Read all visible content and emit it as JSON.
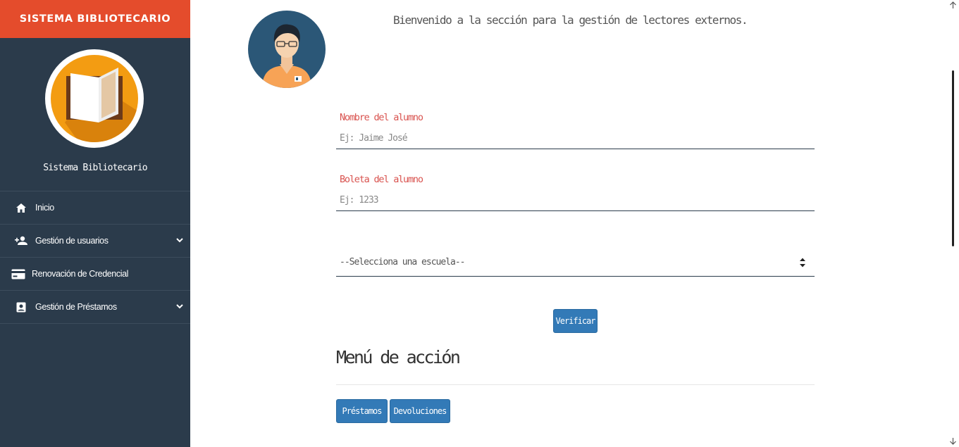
{
  "sidebar": {
    "brand": "SISTEMA BIBLIOTECARIO",
    "logo_icon": "open-book-logo",
    "user_label": "Sistema Bibliotecario",
    "items": [
      {
        "label": "Inicio",
        "icon": "home-icon",
        "has_submenu": false
      },
      {
        "label": "Gestión de usuarios",
        "icon": "add-user-icon",
        "has_submenu": true
      },
      {
        "label": "Renovación de Credencial",
        "icon": "credit-card-icon",
        "has_submenu": false
      },
      {
        "label": "Gestión de Préstamos",
        "icon": "portrait-icon",
        "has_submenu": true
      }
    ]
  },
  "main": {
    "avatar_icon": "user-avatar-illustration",
    "welcome": "Bienvenido a la sección para la gestión de lectores externos.",
    "form": {
      "name_label": "Nombre del alumno",
      "name_placeholder": "Ej: Jaime José",
      "boleta_label": "Boleta del alumno",
      "boleta_placeholder": "Ej: 1233",
      "school_select": "--Selecciona una escuela--",
      "verify_button": "Verificar"
    },
    "action_menu": {
      "title": "Menú de acción",
      "buttons": [
        "Préstamos",
        "Devoluciones"
      ]
    }
  },
  "colors": {
    "brand": "#e44c2c",
    "sidebar": "#2b3b4b",
    "label": "#d9534f",
    "button": "#337ab7",
    "logo": "#f39c12"
  }
}
